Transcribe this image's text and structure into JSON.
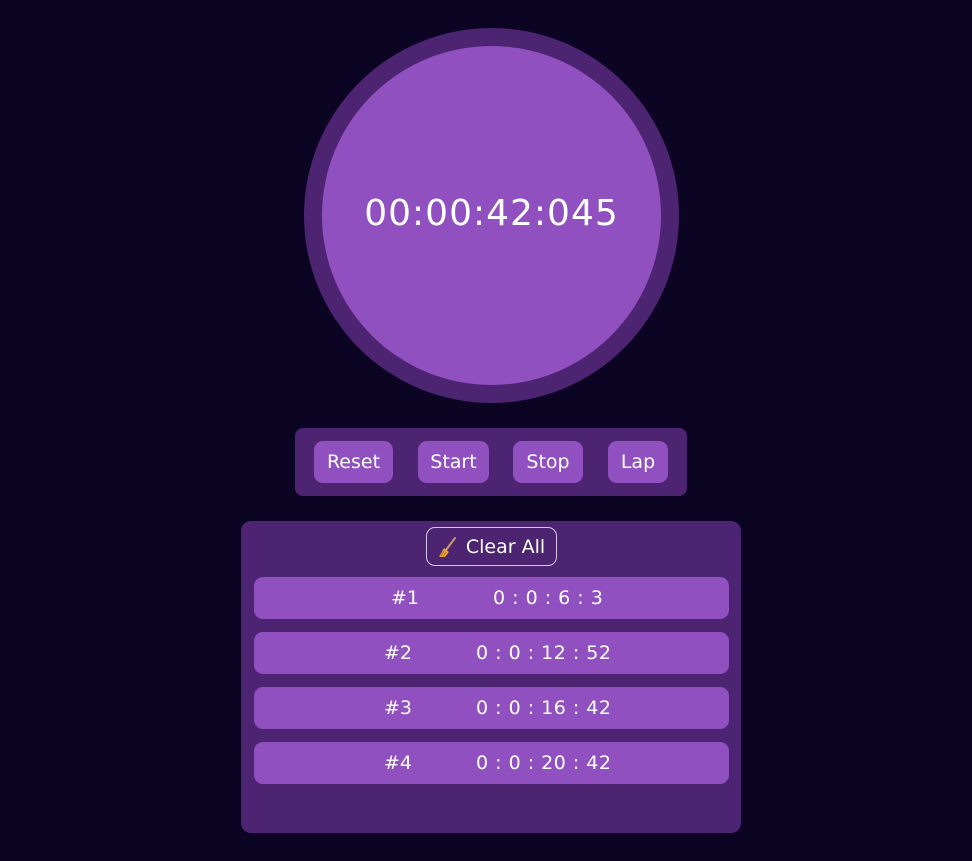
{
  "stopwatch": {
    "display": "00:00:42:045"
  },
  "controls": {
    "reset_label": "Reset",
    "start_label": "Start",
    "stop_label": "Stop",
    "lap_label": "Lap"
  },
  "laps": {
    "clear_label": "Clear All",
    "clear_icon": "broom-icon",
    "items": [
      {
        "index": "#1",
        "time": "0 : 0 : 6 : 3"
      },
      {
        "index": "#2",
        "time": "0 : 0 : 12 : 52"
      },
      {
        "index": "#3",
        "time": "0 : 0 : 16 : 42"
      },
      {
        "index": "#4",
        "time": "0 : 0 : 20 : 42"
      }
    ]
  },
  "colors": {
    "background": "#0c0423",
    "panel": "#4d2471",
    "accent": "#9150c0",
    "text": "#ffffff"
  }
}
